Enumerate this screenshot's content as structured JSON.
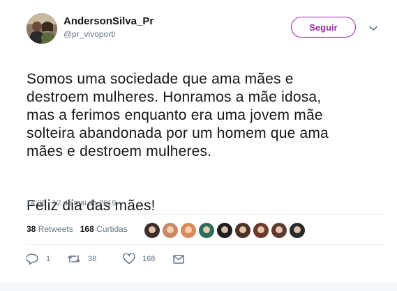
{
  "author": {
    "display_name": "AndersonSilva_Pr",
    "handle": "@pr_vivoporti"
  },
  "follow_button": {
    "label": "Seguir"
  },
  "icons": {
    "caret": "chevron-down-icon",
    "reply": "reply-icon",
    "retweet": "retweet-icon",
    "like": "heart-icon",
    "message": "envelope-icon"
  },
  "tweet": {
    "text_paragraph_1": "Somos uma sociedade que ama mães e\ndestroem mulheres. Honramos a mãe idosa,\nmas a ferimos enquanto era uma jovem mãe\nsolteira abandonada por um homem que ama\nmães e destroem mulheres.",
    "text_paragraph_2": "Feliz dia das mães!",
    "timestamp": "14:35 - 12 de mai de 2019"
  },
  "stats": {
    "retweets_count": "38",
    "retweets_label": "Retweets",
    "likes_count": "168",
    "likes_label": "Curtidas"
  },
  "liker_avatars": [
    "#3a2f2a",
    "#c98a6a",
    "#d98a5a",
    "#2e6b5a",
    "#1e1e1e",
    "#4a3028",
    "#6b3a2a",
    "#5a3a30",
    "#2a2a2a",
    "#3c4a5a"
  ],
  "actions": {
    "reply_count": "1",
    "retweet_count": "38",
    "like_count": "168"
  },
  "colors": {
    "accent": "#9c27b0",
    "text": "#14171a",
    "secondary_text": "#657786",
    "divider": "#e6ecf0"
  }
}
